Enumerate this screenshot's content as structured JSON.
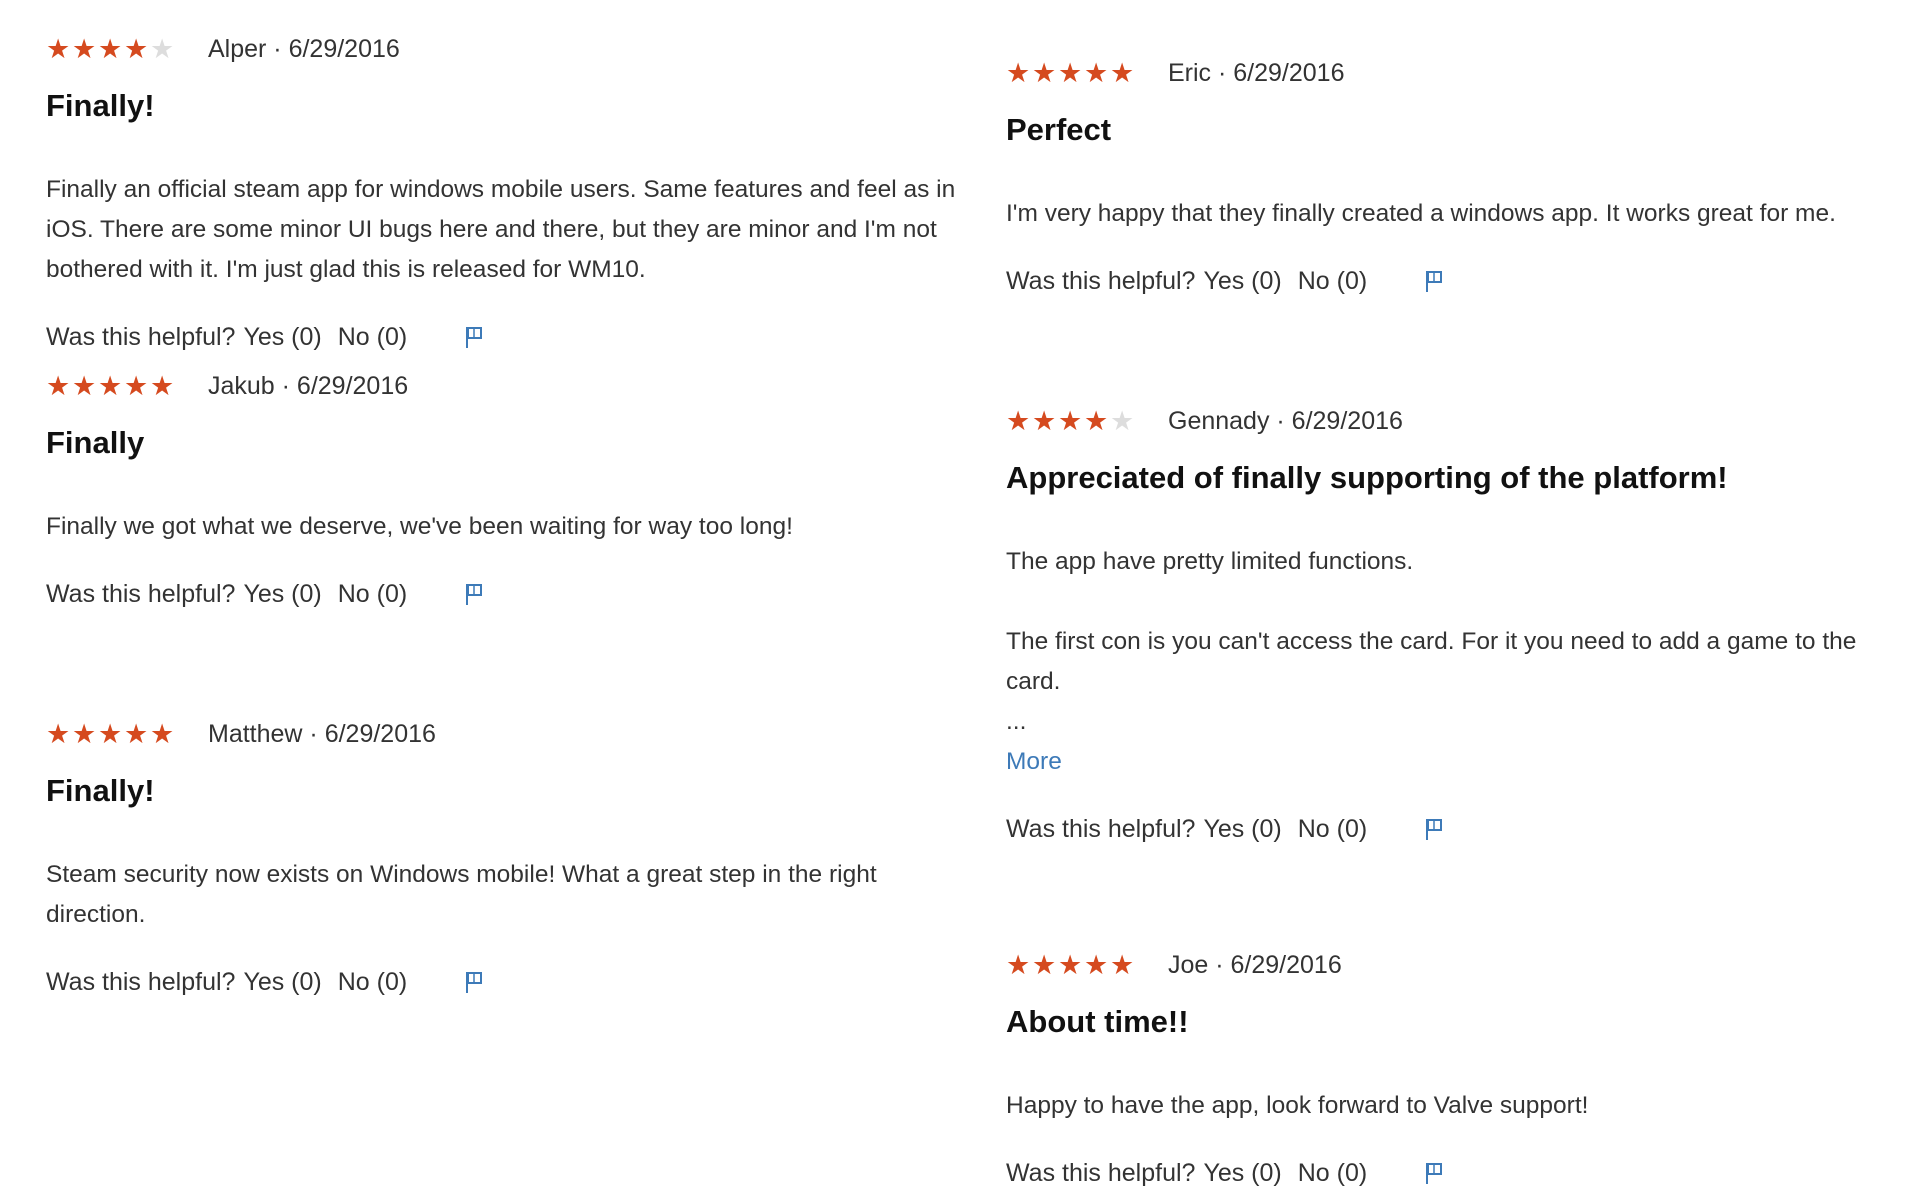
{
  "colors": {
    "star_filled": "#d54a1f",
    "star_empty": "#dddddd",
    "link": "#3d7ab8"
  },
  "icons": {
    "star": "★",
    "flag": "flag-icon"
  },
  "reviews_left": [
    {
      "rating": 4,
      "max_rating": 5,
      "meta": "Alper · 6/29/2016",
      "title": "Finally!",
      "body": [
        "Finally an official steam app for windows mobile users. Same features and feel as in iOS. There are some minor UI bugs here and there, but they are minor and I'm not bothered with it. I'm just glad this is released for WM10."
      ],
      "helpful_question": "Was this helpful?",
      "yes_label": "Yes (0)",
      "no_label": "No (0)"
    },
    {
      "rating": 5,
      "max_rating": 5,
      "meta": "Jakub · 6/29/2016",
      "title": "Finally",
      "body": [
        "Finally we got what we deserve, we've been waiting for way too long!"
      ],
      "helpful_question": "Was this helpful?",
      "yes_label": "Yes (0)",
      "no_label": "No (0)"
    },
    {
      "rating": 5,
      "max_rating": 5,
      "meta": "Matthew · 6/29/2016",
      "title": "Finally!",
      "body": [
        "Steam security now exists on Windows mobile! What a great step in the right direction."
      ],
      "helpful_question": "Was this helpful?",
      "yes_label": "Yes (0)",
      "no_label": "No (0)"
    }
  ],
  "reviews_right": [
    {
      "rating": 5,
      "max_rating": 5,
      "meta": "Eric · 6/29/2016",
      "title": "Perfect",
      "body": [
        "I'm very happy that they finally created a windows app. It works great for me."
      ],
      "helpful_question": "Was this helpful?",
      "yes_label": "Yes (0)",
      "no_label": "No (0)"
    },
    {
      "rating": 4,
      "max_rating": 5,
      "meta": "Gennady · 6/29/2016",
      "title": "Appreciated of finally supporting of the platform!",
      "body": [
        "The app have pretty limited functions.",
        "The first con is you can't access the card. For it you need to add a game to the card."
      ],
      "ellipsis": "...",
      "more_label": "More",
      "helpful_question": "Was this helpful?",
      "yes_label": "Yes (0)",
      "no_label": "No (0)"
    },
    {
      "rating": 5,
      "max_rating": 5,
      "meta": "Joe · 6/29/2016",
      "title": "About time!!",
      "body": [
        "Happy to have the app, look forward to Valve support!"
      ],
      "helpful_question": "Was this helpful?",
      "yes_label": "Yes (0)",
      "no_label": "No (0)"
    }
  ]
}
